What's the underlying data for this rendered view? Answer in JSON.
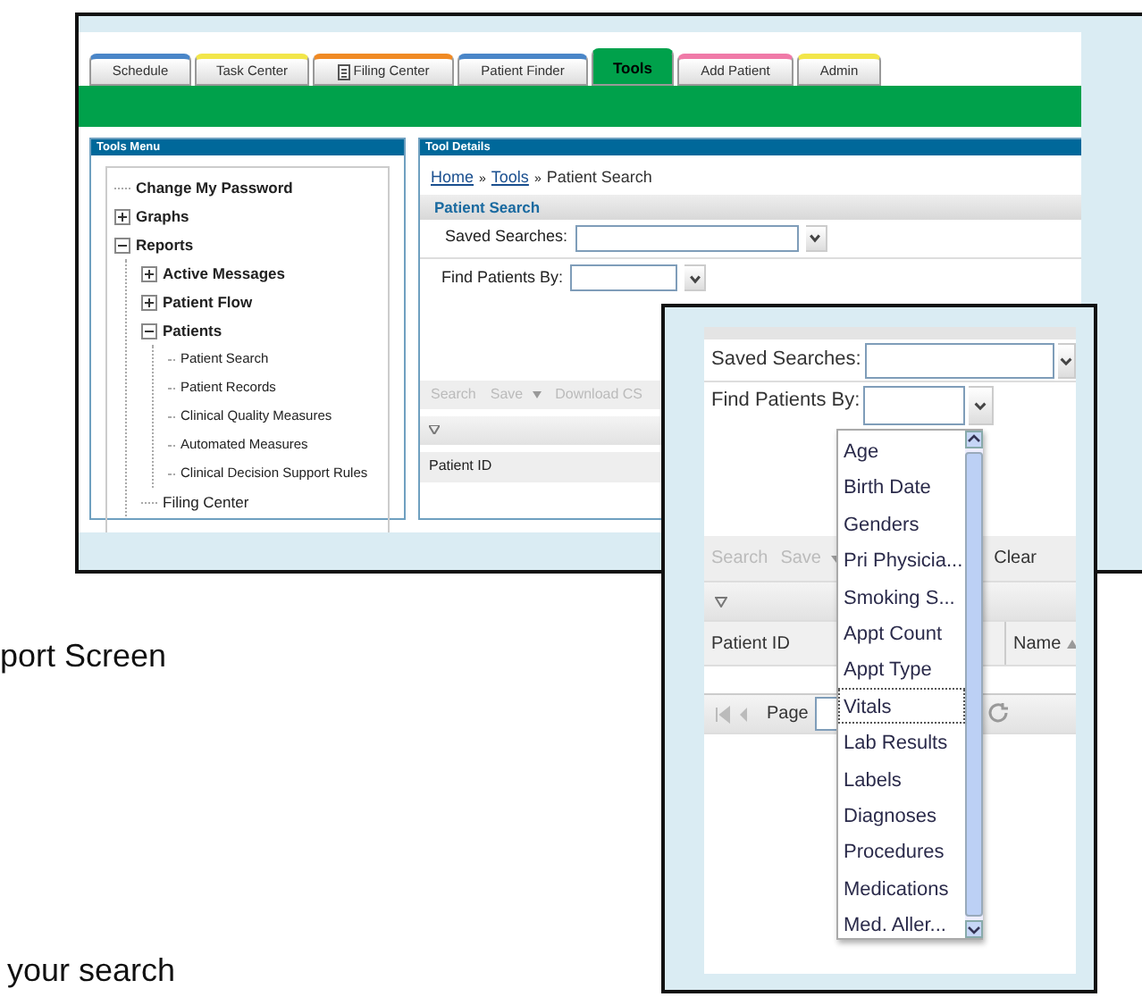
{
  "slide_text": [
    {
      "text": "port Screen"
    },
    {
      "text": "your search"
    }
  ],
  "screenshot_main": {
    "tabs": [
      {
        "label": "Schedule",
        "color": "#4a86c8",
        "selected": false
      },
      {
        "label": "Task Center",
        "color": "#f2e64a",
        "selected": false
      },
      {
        "label": "Filing Center",
        "color": "#f08a24",
        "selected": false,
        "icon": true
      },
      {
        "label": "Patient Finder",
        "color": "#4a86c8",
        "selected": false
      },
      {
        "label": "Tools",
        "color": "#00a14b",
        "selected": true
      },
      {
        "label": "Add Patient",
        "color": "#f07aa8",
        "selected": false
      },
      {
        "label": "Admin",
        "color": "#f2e64a",
        "selected": false
      }
    ],
    "tools_menu": {
      "title": "Tools Menu",
      "tree": [
        {
          "label": "Change My Password"
        },
        {
          "label": "Graphs",
          "expanded": false
        },
        {
          "label": "Reports",
          "expanded": true,
          "children": [
            {
              "label": "Active Messages",
              "expanded": false
            },
            {
              "label": "Patient Flow",
              "expanded": false
            },
            {
              "label": "Patients",
              "expanded": true,
              "children": [
                {
                  "label": "Patient Search"
                },
                {
                  "label": "Patient Records"
                },
                {
                  "label": "Clinical Quality Measures"
                },
                {
                  "label": "Automated Measures"
                },
                {
                  "label": "Clinical Decision Support Rules"
                }
              ]
            },
            {
              "label": "Filing Center"
            }
          ]
        }
      ]
    },
    "tool_details": {
      "title": "Tool Details",
      "breadcrumb": [
        {
          "kind": "link",
          "label": "Home"
        },
        {
          "kind": "separator",
          "label": "»"
        },
        {
          "kind": "link",
          "label": "Tools"
        },
        {
          "kind": "separator",
          "label": "»"
        },
        {
          "kind": "text",
          "label": "Patient Search"
        }
      ],
      "section_title": "Patient Search",
      "saved_searches_label": "Saved Searches:",
      "find_by_label": "Find Patients By:",
      "toolbar": [
        {
          "label": "Search",
          "disabled": true
        },
        {
          "label": "Save",
          "disabled": true,
          "menu": true
        },
        {
          "label": "Download CS",
          "disabled": true
        }
      ],
      "columns": [
        "Patient ID"
      ]
    }
  },
  "screenshot_zoom": {
    "saved_searches_label": "Saved Searches:",
    "find_by_label": "Find Patients By:",
    "toolbar": [
      {
        "label": "Search",
        "disabled": true
      },
      {
        "label": "Save",
        "disabled": true,
        "menu": true
      },
      {
        "label": "Clear",
        "disabled": false
      }
    ],
    "columns": [
      {
        "label": "Patient ID",
        "sorted": false
      },
      {
        "label": "Name",
        "sorted": true
      }
    ],
    "pager": {
      "page_label": "Page"
    },
    "dropdown": [
      {
        "label": "Age",
        "selected": false
      },
      {
        "label": "Birth Date",
        "selected": false
      },
      {
        "label": "Genders",
        "selected": false
      },
      {
        "label": "Pri Physicia...",
        "selected": false
      },
      {
        "label": "Smoking S...",
        "selected": false
      },
      {
        "label": "Appt Count",
        "selected": false
      },
      {
        "label": "Appt Type",
        "selected": false
      },
      {
        "label": "Vitals",
        "selected": true
      },
      {
        "label": "Lab Results",
        "selected": false
      },
      {
        "label": "Labels",
        "selected": false
      },
      {
        "label": "Diagnoses",
        "selected": false
      },
      {
        "label": "Procedures",
        "selected": false
      },
      {
        "label": "Medications",
        "selected": false
      },
      {
        "label": "Med. Aller...",
        "selected": false
      }
    ]
  }
}
